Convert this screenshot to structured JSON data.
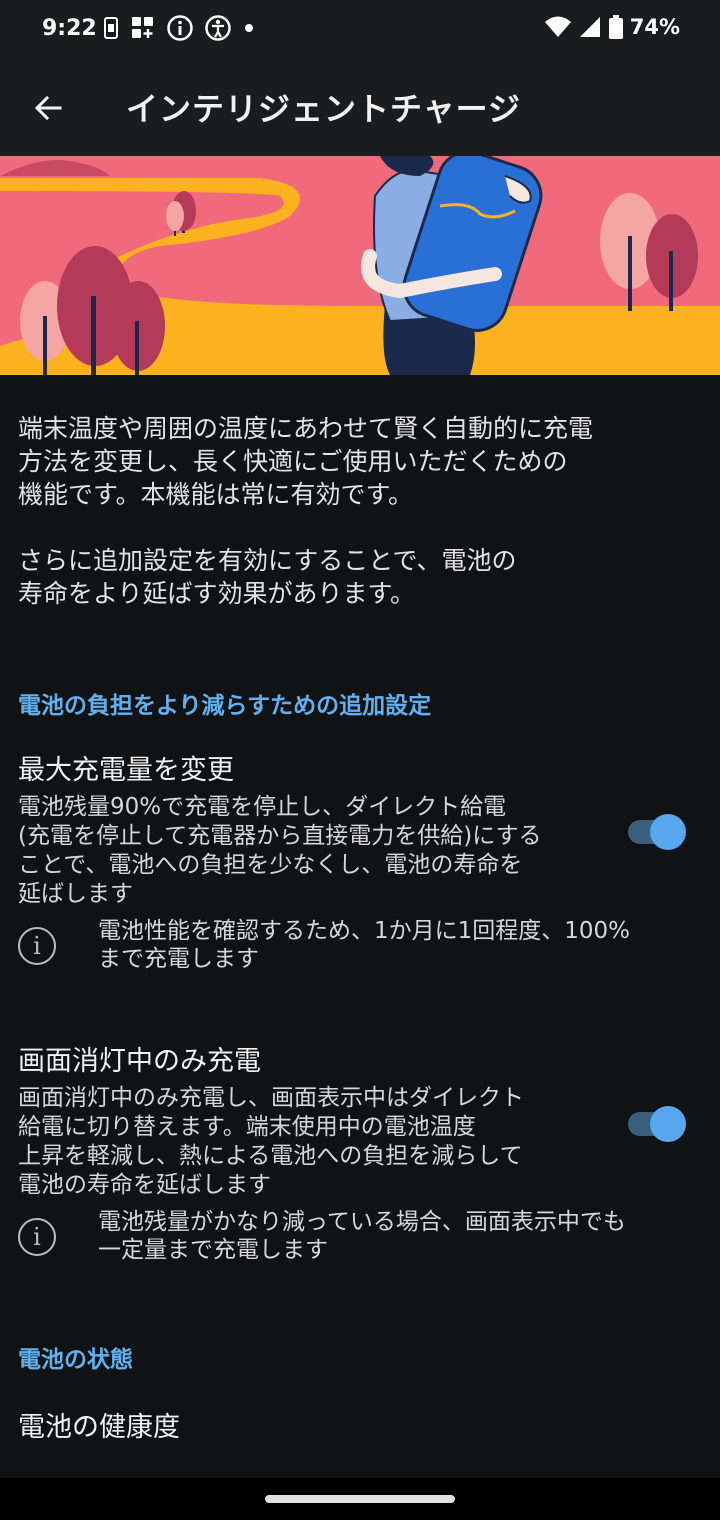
{
  "status_bar": {
    "time": "9:22",
    "battery_percent": "74%",
    "icons": [
      "sim-icon",
      "widget-add-icon",
      "info-circle-icon",
      "accessibility-icon",
      "dot-icon",
      "wifi-icon",
      "signal-icon",
      "battery-icon"
    ]
  },
  "app_bar": {
    "title": "インテリジェントチャージ",
    "back_icon": "back-arrow-icon"
  },
  "hero": {
    "colors": {
      "sky": "#f16a7b",
      "path": "#fbb21e",
      "shirt": "#8aaee4",
      "pants": "#1b2a4a",
      "battery": "#2a6fd6",
      "tree_light": "#f5a5a3",
      "tree_dark": "#b33a58"
    }
  },
  "intro": {
    "line_1": "端末温度や周囲の温度にあわせて賢く自動的に充電",
    "line_2": "方法を変更し、長く快適にご使用いただくための",
    "line_3": "機能です。本機能は常に有効です。",
    "line_4": "さらに追加設定を有効にすることで、電池の",
    "line_5": "寿命をより延ばす効果があります。"
  },
  "section_extra": {
    "header": "電池の負担をより減らすための追加設定"
  },
  "setting_max_charge": {
    "title": "最大充電量を変更",
    "desc_1": "電池残量90%で充電を停止し、ダイレクト給電",
    "desc_2": "(充電を停止して充電器から直接電力を供給)にする",
    "desc_3": "ことで、電池への負担を少なくし、電池の寿命を",
    "desc_4": "延ばします",
    "note_1": "電池性能を確認するため、1か月に1回程度、100%",
    "note_2": "まで充電します",
    "enabled": true
  },
  "setting_screen_off": {
    "title": "画面消灯中のみ充電",
    "desc_1": "画面消灯中のみ充電し、画面表示中はダイレクト",
    "desc_2": "給電に切り替えます。端末使用中の電池温度",
    "desc_3": "上昇を軽減し、熱による電池への負担を減らして",
    "desc_4": "電池の寿命を延ばします",
    "note_1": "電池残量がかなり減っている場合、画面表示中でも",
    "note_2": "一定量まで充電します",
    "enabled": true
  },
  "section_state": {
    "header": "電池の状態",
    "health_label": "電池の健康度"
  },
  "accent_color": "#5fb1ef"
}
